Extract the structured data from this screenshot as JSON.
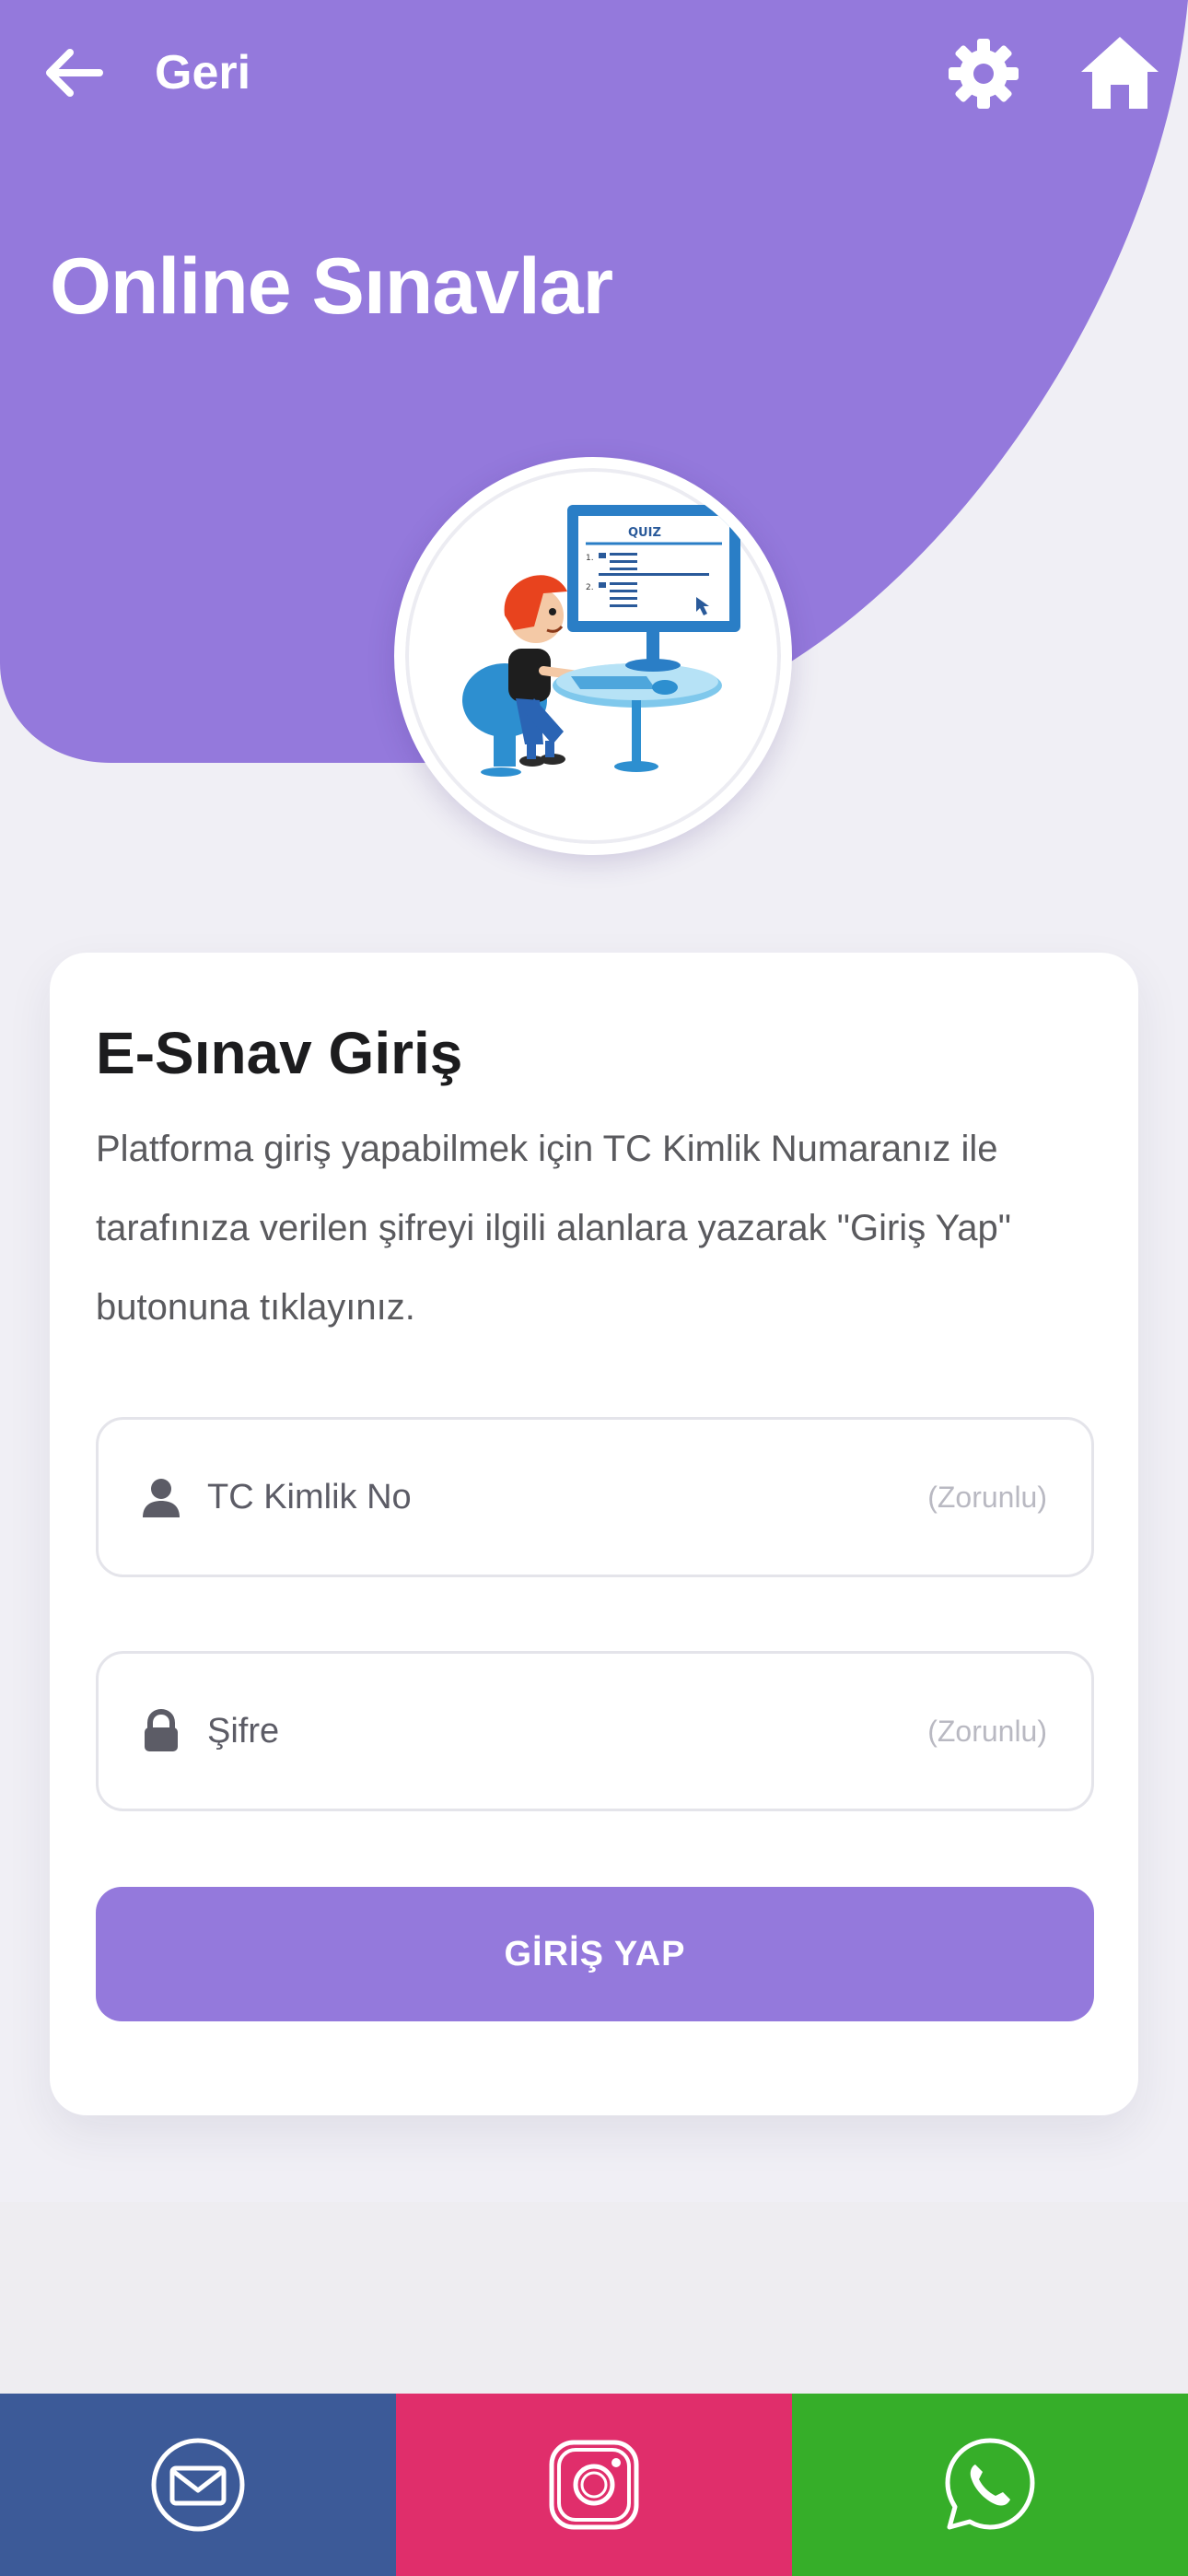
{
  "colors": {
    "header": "#9479dc",
    "button": "#9479dc",
    "mail": "#3c5a98",
    "instagram": "#e02e6b",
    "whatsapp": "#36ae29"
  },
  "header": {
    "back_label": "Geri",
    "title": "Online Sınavlar",
    "settings_icon": "gear-icon",
    "home_icon": "home-icon",
    "illustration_text": "QUIZ"
  },
  "login": {
    "title": "E-Sınav Giriş",
    "description": "Platforma giriş yapabilmek için TC Kimlik Numaranız ile tarafınıza verilen şifreyi ilgili alanlara yazarak \"Giriş Yap\" butonuna tıklayınız.",
    "tc_label": "TC Kimlik No",
    "tc_required": "(Zorunlu)",
    "password_label": "Şifre",
    "password_required": "(Zorunlu)",
    "submit_label": "GİRİŞ YAP"
  },
  "footer": {
    "icons": [
      "mail-icon",
      "instagram-icon",
      "whatsapp-icon"
    ]
  }
}
